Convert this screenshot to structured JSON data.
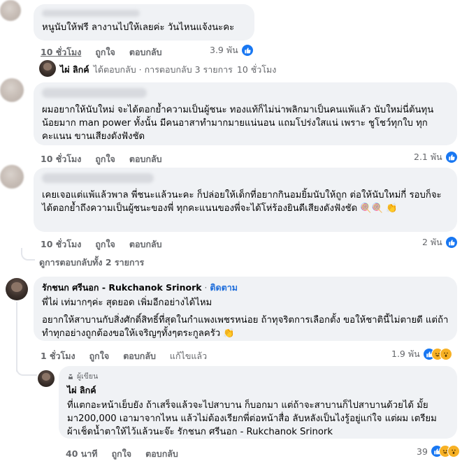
{
  "comments": [
    {
      "text": "หนูนับให้ฟรี ลางานไปให้เลยค่ะ วันไหนแจ้งนะคะ",
      "time": "10 ชั่วโมง",
      "like_label": "ถูกใจ",
      "reply_label": "ตอบกลับ",
      "reaction_count": "3.9 พัน"
    },
    {
      "paragraphs": [
        "ผมอยากให้นับใหม่ จะได้ตอกย้ำความเป็นผู้ชนะ ทองแท้ก็ไม่น่าพลิกมาเป็นคนแพ้แล้ว นับใหม่นี่ต้นทุนน้อยมาก man power ทั้งนั้น มีคนอาสาทำมากมายแน่นอน แถมโปร่งใสแน่ เพราะ ชูโชว์ทุกใบ ทุกคะแนน ขานเสียงดังฟังชัด"
      ],
      "time": "10 ชั่วโมง",
      "like_label": "ถูกใจ",
      "reply_label": "ตอบกลับ",
      "reaction_count": "2.1 พัน"
    },
    {
      "paragraphs": [
        "เคยเจอแต่แพ้แล้วพาล พี่ชนะแล้วนะคะ ก็ปล่อยให้เด็กที่อยากกินอมยิ้มนับให้ถูก ต่อให้นับใหม่กี่ รอบก็จะได้ตอกย้ำถึงความเป็นผู้ชนะของพี่ ทุกคะแนนของพี่จะได้โห่ร้องยินดีเสียงดังฟังชัด 🍭🍭 👏"
      ],
      "time": "10 ชั่วโมง",
      "like_label": "ถูกใจ",
      "reply_label": "ตอบกลับ",
      "reaction_count": "2 พัน"
    },
    {
      "name": "รักชนก ศรีนอก - Rukchanok Srinork",
      "follow_label": "ติดตาม",
      "paragraphs": [
        "พี่ไผ่ เท่มากๆค่ะ สุดยอด เพิ่มอีกอย่างได้ไหม",
        "อยากให้สาบานกับสิ่งศักดิ์สิทธิ์ที่สุดในกำแพงเพชรหน่อย ถ้าทุจริตการเลือกตั้ง ขอให้ชาตินี้ไม่ตายดี แต่ถ้าทำทุกอย่างถูกต้องขอให้เจริญๆทั้งๆตระกูลครัว 👏"
      ],
      "time": "1 ชั่วโมง",
      "like_label": "ถูกใจ",
      "reply_label": "ตอบกลับ",
      "edited_label": "แก้ไขแล้ว",
      "reaction_count": "1.9 พัน"
    },
    {
      "badge": "ผู้เขียน",
      "name": "ไผ่ ลิกค์",
      "paragraphs": [
        "ที่แตกอะหน้าเย็บยัง ถ้าเสร็จแล้วจะไปสาบาน ก็บอกมา แต่ถ้าจะสาบานก็ไปสาบานด้วยได้ มั้ยมา200,000 เอามาจากไหน แล้วไม่ต้องเรียกพี่ต่อหน้าสื่อ ลับหลังเป็นไงรู้อยู่แก่ใจ แต่ผม เตรียม ผ้าเช็ดน้ำตาให้ไว้แล้วนะจ๊ะ รักชนก ศรีนอก - Rukchanok Srinork"
      ],
      "time": "40 นาที",
      "like_label": "ถูกใจ",
      "reply_label": "ตอบกลับ",
      "reaction_count": "39"
    }
  ],
  "reply_summary": {
    "name": "ไผ่ ลิกค์",
    "text": "ได้ตอบกลับ · การตอบกลับ 3 รายการ",
    "time": "10 ชั่วโมง"
  },
  "view_replies": "ดูการตอบกลับทั้ง 2 รายการ",
  "colors": {
    "bubble": "#f0f2f5",
    "meta": "#65676b",
    "like": "#1877f2",
    "follow": "#216fdb"
  },
  "icons": [
    "like-icon",
    "haha-icon",
    "wow-icon",
    "reply-arrow-icon",
    "author-badge-icon"
  ]
}
